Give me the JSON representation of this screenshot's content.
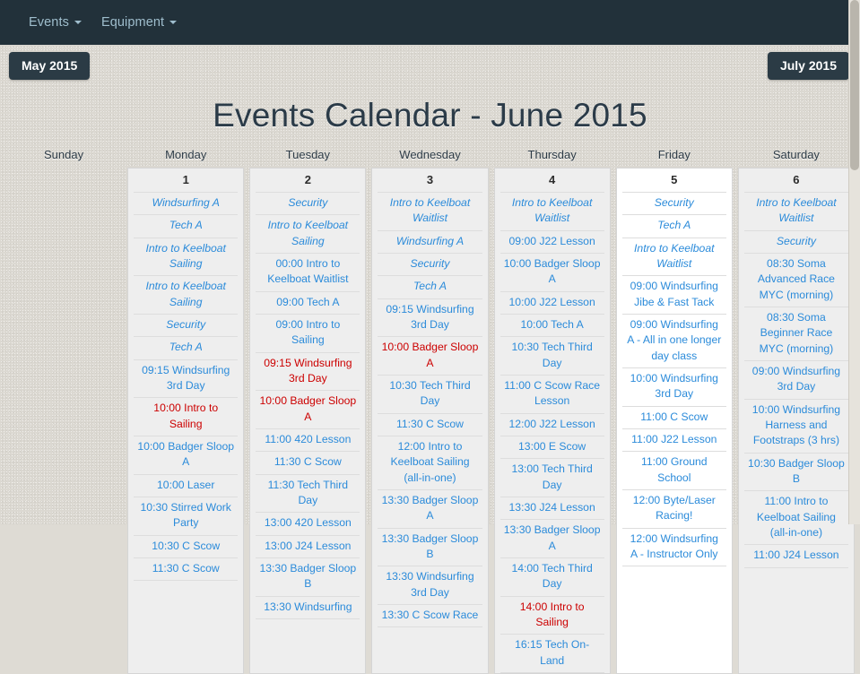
{
  "navbar": {
    "items": [
      {
        "label": "Events",
        "icon": "chevron-down-icon"
      },
      {
        "label": "Equipment",
        "icon": "chevron-down-icon"
      }
    ]
  },
  "month_nav": {
    "prev_label": "May 2015",
    "next_label": "July 2015"
  },
  "title": "Events Calendar - June 2015",
  "colors": {
    "navbar_bg": "#22313a",
    "nav_link": "#9fbecd",
    "page_bg": "#dbd8d1",
    "cell_bg": "#eeeeee",
    "today_bg": "#ffffff",
    "event_link": "#2b8bda",
    "event_full": "#cc0000",
    "title": "#2b3b48"
  },
  "calendar": {
    "daynames": [
      "Sunday",
      "Monday",
      "Tuesday",
      "Wednesday",
      "Thursday",
      "Friday",
      "Saturday"
    ],
    "days": [
      {
        "daynum": "",
        "empty": true,
        "today": false,
        "events": []
      },
      {
        "daynum": "1",
        "empty": false,
        "today": false,
        "events": [
          {
            "text": "Windsurfing A",
            "style": "pending"
          },
          {
            "text": "Tech A",
            "style": "pending"
          },
          {
            "text": "Intro to Keelboat Sailing",
            "style": "pending"
          },
          {
            "text": "Intro to Keelboat Sailing",
            "style": "pending"
          },
          {
            "text": "Security",
            "style": "pending"
          },
          {
            "text": "Tech A",
            "style": "pending"
          },
          {
            "text": "09:15 Windsurfing 3rd Day",
            "style": "normal"
          },
          {
            "text": "10:00 Intro to Sailing",
            "style": "red"
          },
          {
            "text": "10:00 Badger Sloop A",
            "style": "normal"
          },
          {
            "text": "10:00 Laser",
            "style": "normal"
          },
          {
            "text": "10:30 Stirred Work Party",
            "style": "normal"
          },
          {
            "text": "10:30 C Scow",
            "style": "normal"
          },
          {
            "text": "11:30 C Scow",
            "style": "normal"
          }
        ]
      },
      {
        "daynum": "2",
        "empty": false,
        "today": false,
        "events": [
          {
            "text": "Security",
            "style": "pending"
          },
          {
            "text": "Intro to Keelboat Sailing",
            "style": "pending"
          },
          {
            "text": "00:00 Intro to Keelboat Waitlist",
            "style": "normal"
          },
          {
            "text": "09:00 Tech A",
            "style": "normal"
          },
          {
            "text": "09:00 Intro to Sailing",
            "style": "normal"
          },
          {
            "text": "09:15 Windsurfing 3rd Day",
            "style": "red"
          },
          {
            "text": "10:00 Badger Sloop A",
            "style": "red"
          },
          {
            "text": "11:00 420 Lesson",
            "style": "normal"
          },
          {
            "text": "11:30 C Scow",
            "style": "normal"
          },
          {
            "text": "11:30 Tech Third Day",
            "style": "normal"
          },
          {
            "text": "13:00 420 Lesson",
            "style": "normal"
          },
          {
            "text": "13:00 J24 Lesson",
            "style": "normal"
          },
          {
            "text": "13:30 Badger Sloop B",
            "style": "normal"
          },
          {
            "text": "13:30 Windsurfing",
            "style": "normal"
          }
        ]
      },
      {
        "daynum": "3",
        "empty": false,
        "today": false,
        "events": [
          {
            "text": "Intro to Keelboat Waitlist",
            "style": "pending"
          },
          {
            "text": "Windsurfing A",
            "style": "pending"
          },
          {
            "text": "Security",
            "style": "pending"
          },
          {
            "text": "Tech A",
            "style": "pending"
          },
          {
            "text": "09:15 Windsurfing 3rd Day",
            "style": "normal"
          },
          {
            "text": "10:00 Badger Sloop A",
            "style": "red"
          },
          {
            "text": "10:30 Tech Third Day",
            "style": "normal"
          },
          {
            "text": "11:30 C Scow",
            "style": "normal"
          },
          {
            "text": "12:00 Intro to Keelboat Sailing (all-in-one)",
            "style": "normal"
          },
          {
            "text": "13:30 Badger Sloop A",
            "style": "normal"
          },
          {
            "text": "13:30 Badger Sloop B",
            "style": "normal"
          },
          {
            "text": "13:30 Windsurfing 3rd Day",
            "style": "normal"
          },
          {
            "text": "13:30 C Scow Race",
            "style": "normal"
          }
        ]
      },
      {
        "daynum": "4",
        "empty": false,
        "today": false,
        "events": [
          {
            "text": "Intro to Keelboat Waitlist",
            "style": "pending"
          },
          {
            "text": "09:00 J22 Lesson",
            "style": "normal"
          },
          {
            "text": "10:00 Badger Sloop A",
            "style": "normal"
          },
          {
            "text": "10:00 J22 Lesson",
            "style": "normal"
          },
          {
            "text": "10:00 Tech A",
            "style": "normal"
          },
          {
            "text": "10:30 Tech Third Day",
            "style": "normal"
          },
          {
            "text": "11:00 C Scow Race Lesson",
            "style": "normal"
          },
          {
            "text": "12:00 J22 Lesson",
            "style": "normal"
          },
          {
            "text": "13:00 E Scow",
            "style": "normal"
          },
          {
            "text": "13:00 Tech Third Day",
            "style": "normal"
          },
          {
            "text": "13:30 J24 Lesson",
            "style": "normal"
          },
          {
            "text": "13:30 Badger Sloop A",
            "style": "normal"
          },
          {
            "text": "14:00 Tech Third Day",
            "style": "normal"
          },
          {
            "text": "14:00 Intro to Sailing",
            "style": "red"
          },
          {
            "text": "16:15 Tech On-Land",
            "style": "normal"
          }
        ]
      },
      {
        "daynum": "5",
        "empty": false,
        "today": true,
        "events": [
          {
            "text": "Security",
            "style": "pending"
          },
          {
            "text": "Tech A",
            "style": "pending"
          },
          {
            "text": "Intro to Keelboat Waitlist",
            "style": "pending"
          },
          {
            "text": "09:00 Windsurfing Jibe & Fast Tack",
            "style": "normal"
          },
          {
            "text": "09:00 Windsurfing A - All in one longer day class",
            "style": "normal"
          },
          {
            "text": "10:00 Windsurfing 3rd Day",
            "style": "normal"
          },
          {
            "text": "11:00 C Scow",
            "style": "normal"
          },
          {
            "text": "11:00 J22 Lesson",
            "style": "normal"
          },
          {
            "text": "11:00 Ground School",
            "style": "normal"
          },
          {
            "text": "12:00 Byte/Laser Racing!",
            "style": "normal"
          },
          {
            "text": "12:00 Windsurfing A - Instructor Only",
            "style": "normal"
          }
        ]
      },
      {
        "daynum": "6",
        "empty": false,
        "today": false,
        "events": [
          {
            "text": "Intro to Keelboat Waitlist",
            "style": "pending"
          },
          {
            "text": "Security",
            "style": "pending"
          },
          {
            "text": "08:30 Soma Advanced Race MYC (morning)",
            "style": "normal"
          },
          {
            "text": "08:30 Soma Beginner Race MYC (morning)",
            "style": "normal"
          },
          {
            "text": "09:00 Windsurfing 3rd Day",
            "style": "normal"
          },
          {
            "text": "10:00 Windsurfing Harness and Footstraps (3 hrs)",
            "style": "normal"
          },
          {
            "text": "10:30 Badger Sloop B",
            "style": "normal"
          },
          {
            "text": "11:00 Intro to Keelboat Sailing (all-in-one)",
            "style": "normal"
          },
          {
            "text": "11:00 J24 Lesson",
            "style": "normal"
          }
        ]
      }
    ]
  }
}
